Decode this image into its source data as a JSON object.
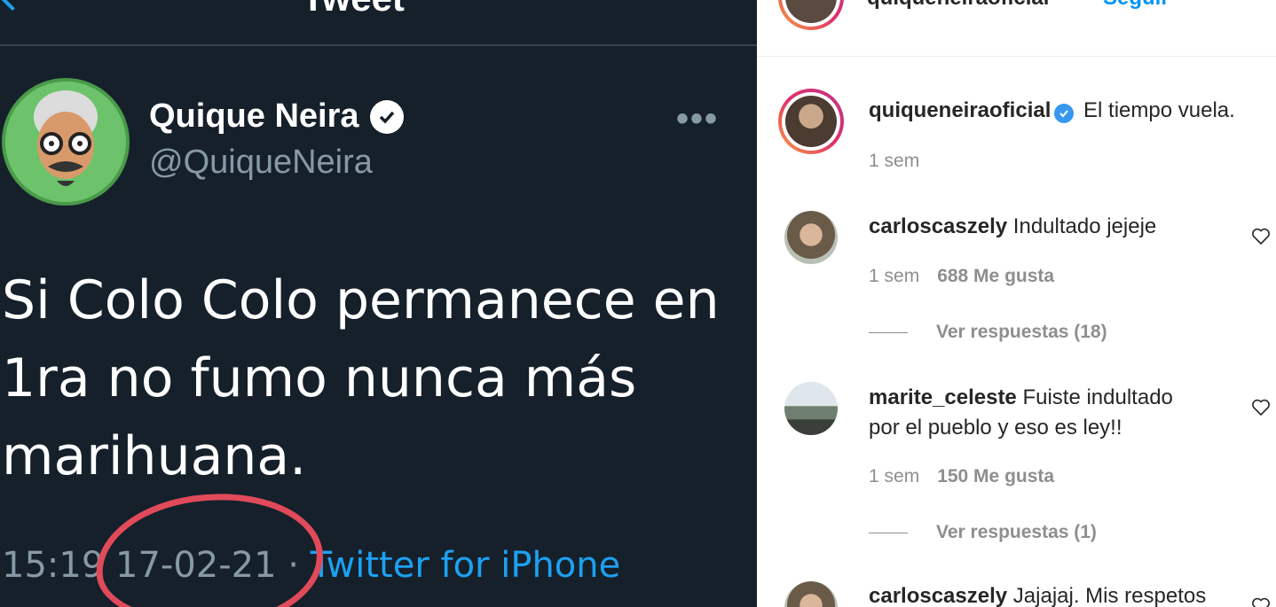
{
  "tweet": {
    "header_title": "Tweet",
    "name": "Quique Neira",
    "handle": "@QuiqueNeira",
    "more": "•••",
    "text": "Si Colo Colo permanece en 1ra no fumo nunca más marihuana.",
    "time": "15:19",
    "date": "17-02-21",
    "separator": "·",
    "source": "Twitter for iPhone"
  },
  "instagram": {
    "top": {
      "username": "quiqueneiraoficial",
      "follow_label": "Seguir"
    },
    "caption": {
      "username": "quiqueneiraoficial",
      "text": "El tiempo vuela.",
      "time": "1 sem"
    },
    "comments": [
      {
        "username": "carloscaszely",
        "text": "Indultado jejeje",
        "time": "1 sem",
        "likes": "688 Me gusta",
        "replies": "Ver respuestas (18)"
      },
      {
        "username": "marite_celeste",
        "text_line1": "Fuiste indultado",
        "text_line2": "por el pueblo y eso es ley!!",
        "time": "1 sem",
        "likes": "150 Me gusta",
        "replies": "Ver respuestas (1)"
      },
      {
        "username": "carloscaszely",
        "text": "Jajajaj. Mis respetos"
      }
    ]
  },
  "colors": {
    "twitter_bg": "#15202b",
    "twitter_blue": "#1da1f2",
    "annotation_red": "#e04a5a",
    "ig_blue": "#0095f6"
  }
}
